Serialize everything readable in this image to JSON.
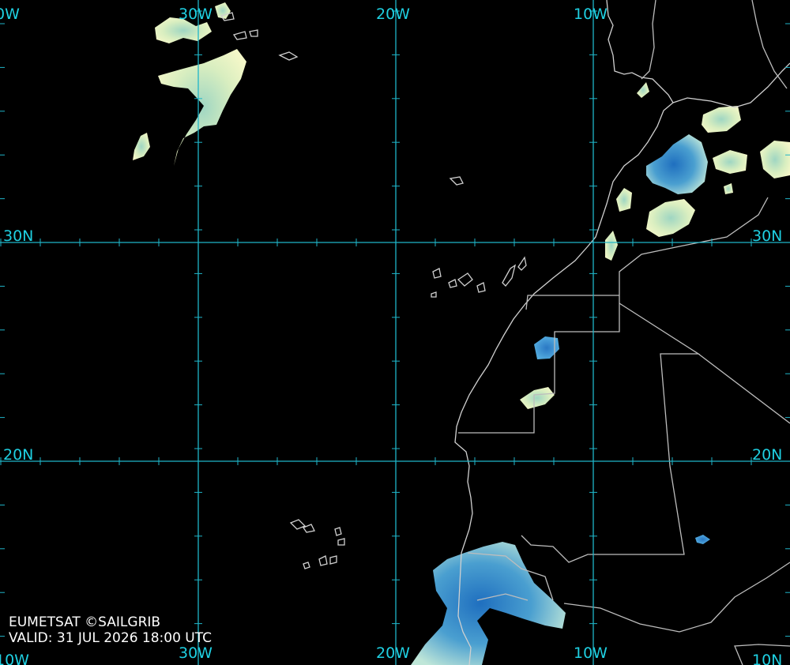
{
  "map": {
    "lon_labels": [
      "0W",
      "30W",
      "20W",
      "10W"
    ],
    "lat_labels": [
      "30N",
      "30N",
      "20N",
      "20N"
    ],
    "bottom_labels": [
      "10W",
      "30W",
      "20W",
      "10W",
      "10N"
    ],
    "colors": {
      "background": "#000000",
      "grid": "#1fb5c8",
      "coastline": "#d0d0d0",
      "cloud_light": "#f1f5c4",
      "cloud_mid": "#8fcfc4",
      "cloud_deep": "#2b7fc6"
    }
  },
  "credit": {
    "line1": "EUMETSAT ©SAILGRIB",
    "line2": "VALID:  31 JUL 2026 18:00 UTC"
  }
}
